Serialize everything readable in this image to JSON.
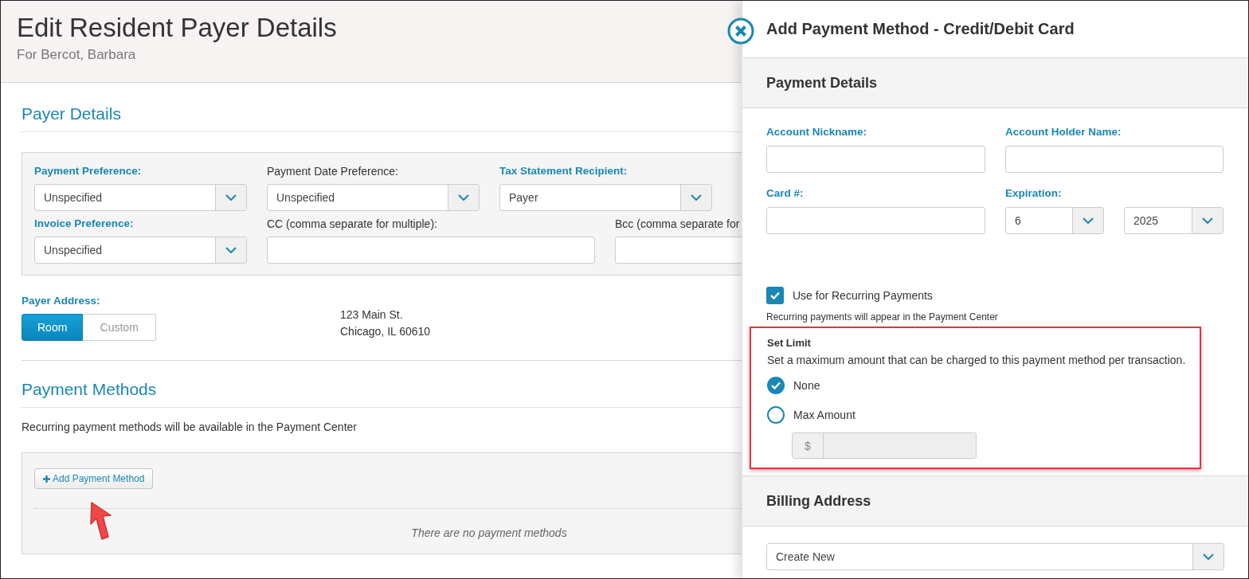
{
  "page": {
    "title": "Edit Resident Payer Details",
    "subtitle": "For Bercot, Barbara"
  },
  "payer_details": {
    "heading": "Payer Details",
    "rows": [
      [
        {
          "kind": "select",
          "label": "Payment Preference:",
          "required": true,
          "value": "Unspecified"
        },
        {
          "kind": "select",
          "label": "Payment Date Preference:",
          "required": false,
          "value": "Unspecified"
        },
        {
          "kind": "select",
          "label": "Tax Statement Recipient:",
          "required": true,
          "value": "Payer"
        }
      ],
      [
        {
          "kind": "select",
          "label": "Invoice Preference:",
          "required": true,
          "value": "Unspecified"
        },
        {
          "kind": "text",
          "label": "CC (comma separate for multiple):",
          "required": false
        },
        {
          "kind": "text",
          "label": "Bcc (comma separate for",
          "required": false
        }
      ]
    ]
  },
  "payer_address": {
    "label": "Payer Address:",
    "options": [
      {
        "label": "Room",
        "selected": true
      },
      {
        "label": "Custom",
        "selected": false
      }
    ],
    "lines": [
      "123 Main St.",
      "Chicago, IL 60610"
    ]
  },
  "payment_methods": {
    "heading": "Payment Methods",
    "note": "Recurring payment methods will be available in the Payment Center",
    "add_button": "Add Payment Method",
    "empty_message": "There are no payment methods"
  },
  "drawer": {
    "title": "Add Payment Method - Credit/Debit Card",
    "payment_details": {
      "heading": "Payment Details",
      "fields": [
        {
          "kind": "text",
          "label": "Account Nickname:"
        },
        {
          "kind": "text",
          "label": "Account Holder Name:"
        },
        {
          "kind": "text",
          "label": "Card #:"
        },
        {
          "kind": "expiry",
          "label": "Expiration:",
          "selects": [
            "6",
            "2025"
          ]
        }
      ]
    },
    "recurring": {
      "label": "Use for Recurring Payments",
      "checked": true,
      "note": "Recurring payments will appear in the Payment Center"
    },
    "set_limit": {
      "heading": "Set Limit",
      "description": "Set a maximum amount that can be charged to this payment method per transaction.",
      "options": [
        {
          "label": "None",
          "selected": true
        },
        {
          "label": "Max Amount",
          "selected": false
        }
      ],
      "amount": {
        "prefix": "$",
        "disabled": true
      }
    },
    "billing_address": {
      "heading": "Billing Address",
      "value": "Create New"
    }
  }
}
